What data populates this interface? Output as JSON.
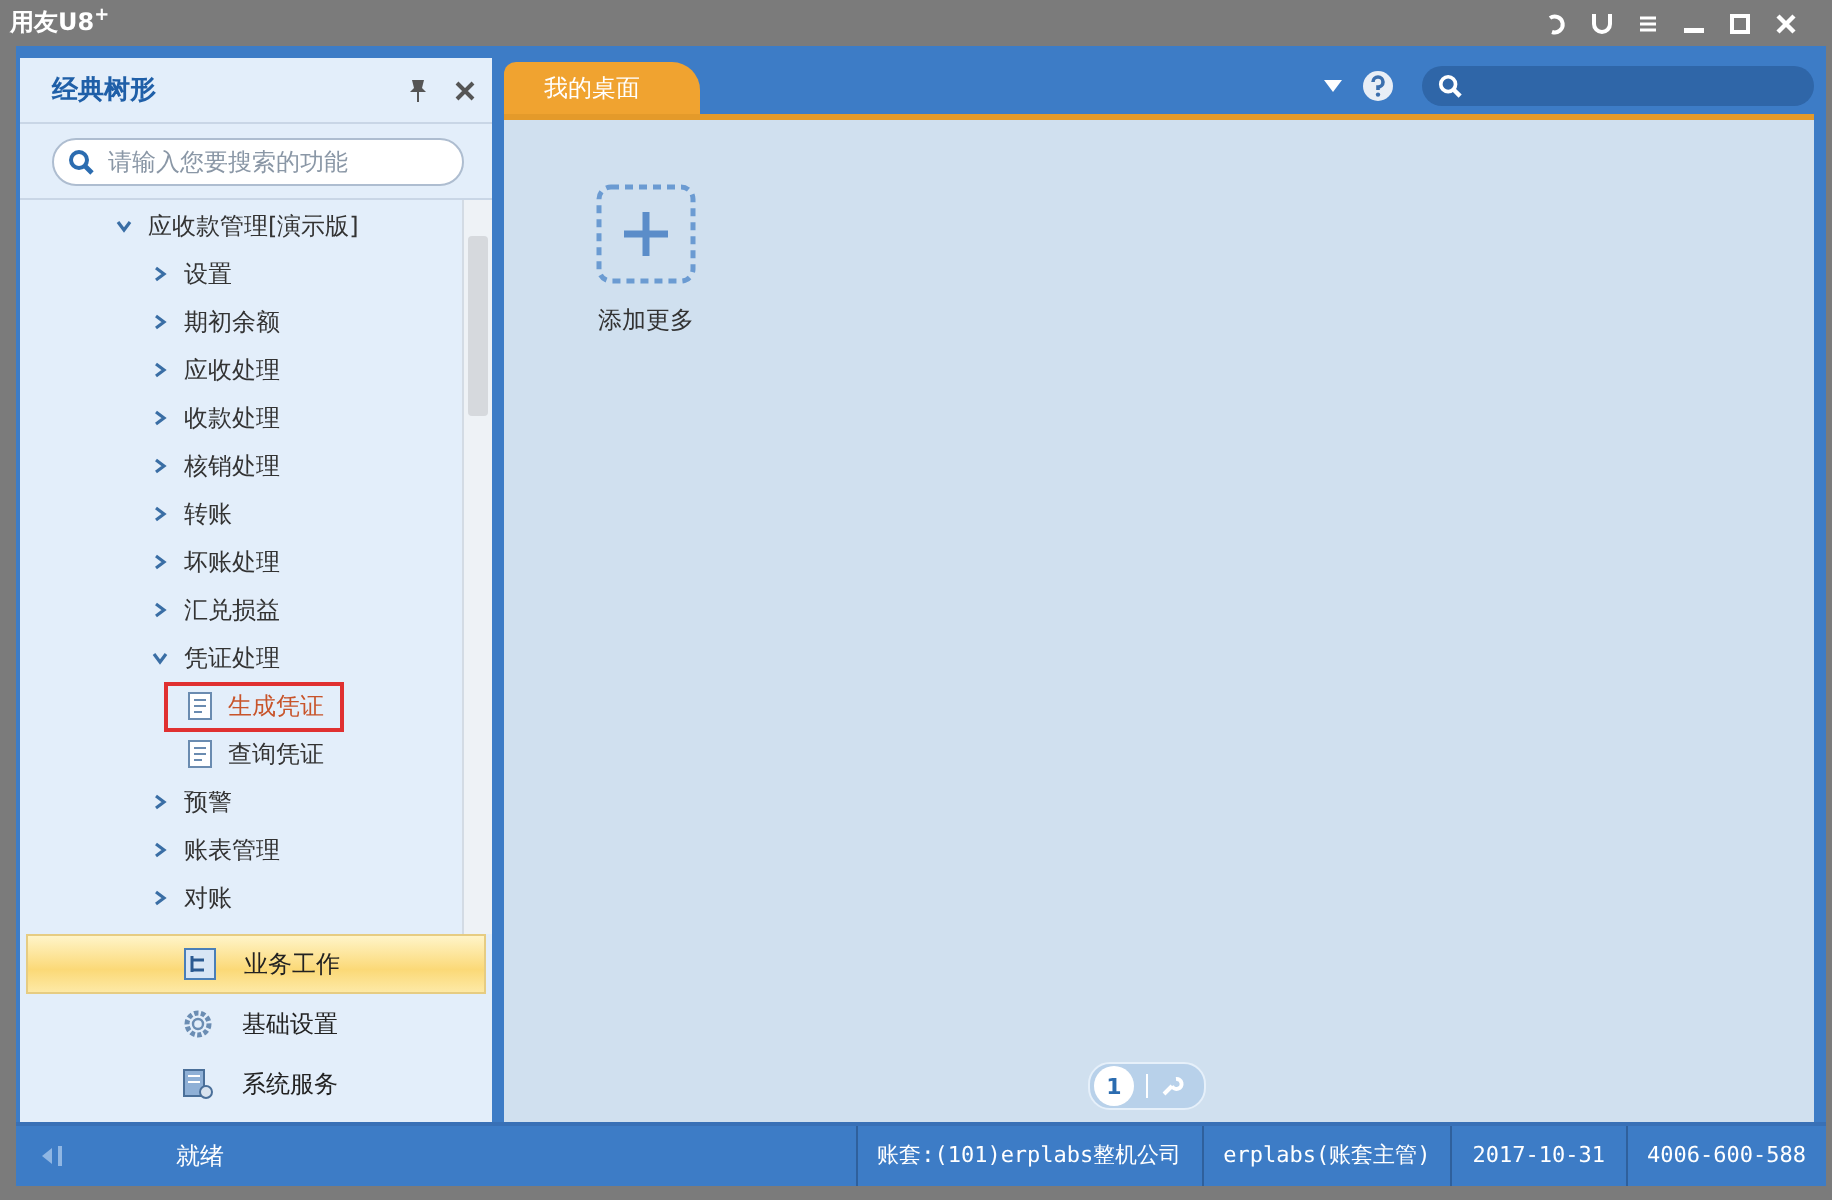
{
  "window": {
    "title": "用友U8",
    "title_sup": "+"
  },
  "sidebar": {
    "title": "经典树形",
    "search": {
      "placeholder": "请输入您要搜索的功能"
    },
    "tree": [
      {
        "label": "应收款管理[演示版]",
        "expanded": true,
        "selected": false,
        "children": [
          {
            "label": "设置",
            "expanded": false,
            "selected": false
          },
          {
            "label": "期初余额",
            "expanded": false,
            "selected": false
          },
          {
            "label": "应收处理",
            "expanded": false,
            "selected": false
          },
          {
            "label": "收款处理",
            "expanded": false,
            "selected": false
          },
          {
            "label": "核销处理",
            "expanded": false,
            "selected": false
          },
          {
            "label": "转账",
            "expanded": false,
            "selected": false
          },
          {
            "label": "坏账处理",
            "expanded": false,
            "selected": false
          },
          {
            "label": "汇兑损益",
            "expanded": false,
            "selected": false
          },
          {
            "label": "凭证处理",
            "expanded": true,
            "selected": false,
            "children": [
              {
                "label": "生成凭证",
                "selected": true
              },
              {
                "label": "查询凭证",
                "selected": false
              }
            ]
          },
          {
            "label": "预警",
            "expanded": false,
            "selected": false
          },
          {
            "label": "账表管理",
            "expanded": false,
            "selected": false
          },
          {
            "label": "对账",
            "expanded": false,
            "selected": false
          }
        ]
      }
    ],
    "nav": [
      {
        "label": "业务工作",
        "kind": "tree",
        "selected": true
      },
      {
        "label": "基础设置",
        "kind": "gear",
        "selected": false
      },
      {
        "label": "系统服务",
        "kind": "server",
        "selected": false
      }
    ]
  },
  "tabs": [
    {
      "label": "我的桌面",
      "selected": true
    }
  ],
  "desktop": {
    "add_label": "添加更多",
    "pages": [
      {
        "label": "1",
        "selected": true
      }
    ]
  },
  "status_bar": {
    "state": "就绪",
    "items": [
      "账套:(101)erplabs整机公司",
      "erplabs(账套主管)",
      "2017-10-31",
      "4006-600-588"
    ]
  }
}
